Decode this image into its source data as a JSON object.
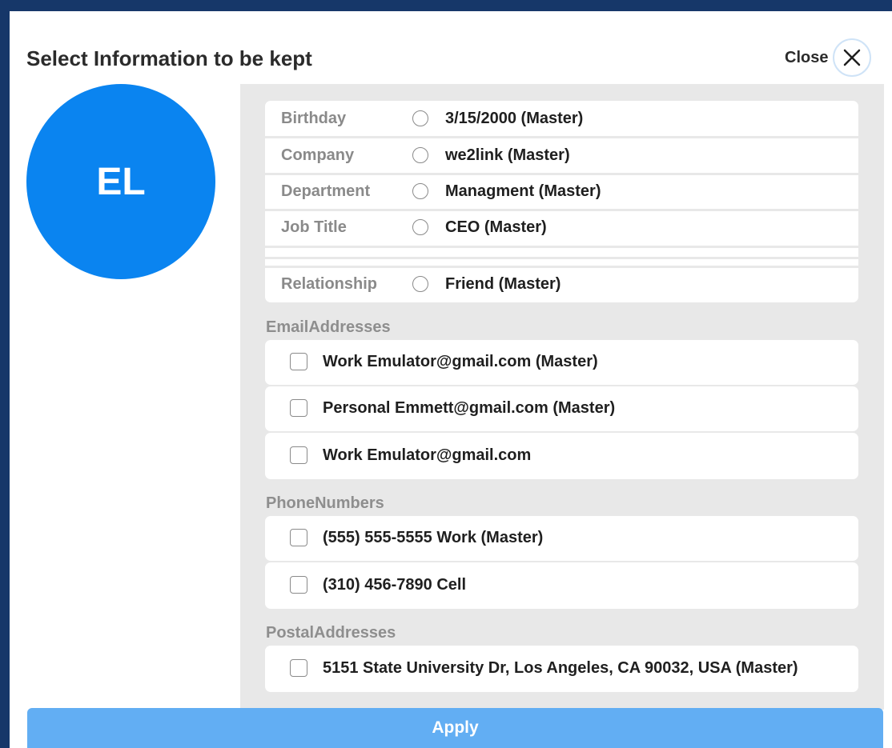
{
  "dialog": {
    "title": "Select Information to be kept",
    "close_label": "Close",
    "apply_label": "Apply"
  },
  "avatar": {
    "initials": "EL",
    "color": "#0a84f0"
  },
  "info_fields": [
    {
      "label": "Birthday",
      "value": "3/15/2000 (Master)"
    },
    {
      "label": "Company",
      "value": "we2link (Master)"
    },
    {
      "label": "Department",
      "value": "Managment (Master)"
    },
    {
      "label": "Job Title",
      "value": "CEO (Master)"
    },
    {
      "label": "",
      "value": ""
    },
    {
      "label": "Relationship",
      "value": "Friend (Master)"
    }
  ],
  "email_section": {
    "label": "EmailAddresses",
    "items": [
      "Work Emulator@gmail.com (Master)",
      "Personal Emmett@gmail.com (Master)",
      "Work Emulator@gmail.com"
    ]
  },
  "phone_section": {
    "label": "PhoneNumbers",
    "items": [
      "(555) 555-5555 Work (Master)",
      "(310) 456-7890 Cell"
    ]
  },
  "postal_section": {
    "label": "PostalAddresses",
    "items": [
      "5151 State University Dr, Los Angeles, CA 90032, USA (Master)"
    ]
  },
  "colors": {
    "background": "#163769",
    "panel": "#e8e8e8",
    "apply": "#62aef3"
  }
}
